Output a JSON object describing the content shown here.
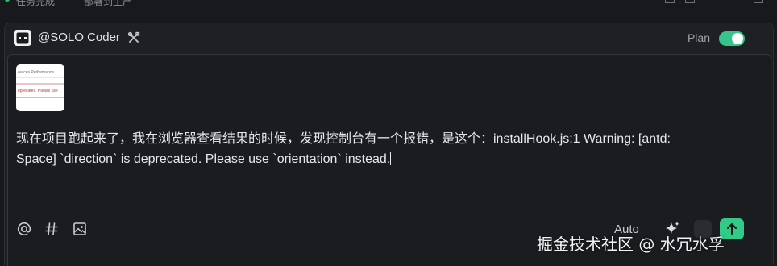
{
  "breadcrumb": {
    "item1": "任务完成",
    "item2": "部署到生产"
  },
  "agent": {
    "name": "@SOLO Coder",
    "badge_icon": "terminal-icon",
    "tools_icon": "tools-icon"
  },
  "plan": {
    "label": "Plan",
    "enabled": true,
    "accent_color": "#36c58a"
  },
  "attachment": {
    "thumb_text_top": "ources   Performance",
    "thumb_text_error": "eprecated. Please use"
  },
  "message": {
    "text": "现在项目跑起来了，我在浏览器查看结果的时候，发现控制台有一个报错，是这个：installHook.js:1 Warning: [antd: Space] `direction` is deprecated. Please use `orientation` instead."
  },
  "toolbar": {
    "mention_icon": "at-icon",
    "hash_icon": "hash-icon",
    "image_icon": "image-icon",
    "model_label": "Auto",
    "sparkle_icon": "sparkle-icon",
    "send_icon": "arrow-up-icon",
    "send_color": "#33c987"
  },
  "watermark": {
    "text": "掘金技术社区 @ 水冗水孚"
  }
}
